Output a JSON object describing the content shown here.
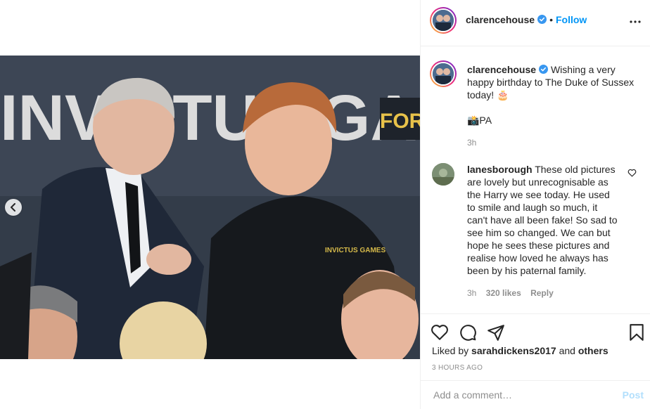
{
  "post": {
    "username": "clarencehouse",
    "follow_label": "Follow",
    "separator": "•",
    "caption": {
      "text": "Wishing a very happy birthday to The Duke of Sussex today! 🎂",
      "credit": "📸PA",
      "time": "3h"
    },
    "photo": {
      "banner_text": "INVICTUS GAMES",
      "side_text": "FOR",
      "jacket_text": "INVICTUS GAMES"
    }
  },
  "comments": [
    {
      "username": "lanesborough",
      "text": "These old pictures are lovely but unrecognisable as the Harry we see today. He used to smile and laugh so much, it can't have all been fake! So sad to see him so changed. We can but hope he sees these pictures and realise how loved he always has been by his paternal family.",
      "time": "3h",
      "likes": "320 likes",
      "reply_label": "Reply"
    }
  ],
  "footer": {
    "liked_by_prefix": "Liked by",
    "liked_by_user": "sarahdickens2017",
    "liked_by_join": "and",
    "liked_by_others": "others",
    "time_ago": "3 HOURS AGO",
    "comment_placeholder": "Add a comment…",
    "post_label": "Post"
  },
  "colors": {
    "accent": "#0095f6",
    "muted": "#8e8e8e",
    "post_disabled": "#b2dffc"
  },
  "icons": [
    "chevron-left-icon",
    "verified-badge-icon",
    "more-options-icon",
    "heart-icon",
    "comment-icon",
    "share-icon",
    "bookmark-icon"
  ]
}
